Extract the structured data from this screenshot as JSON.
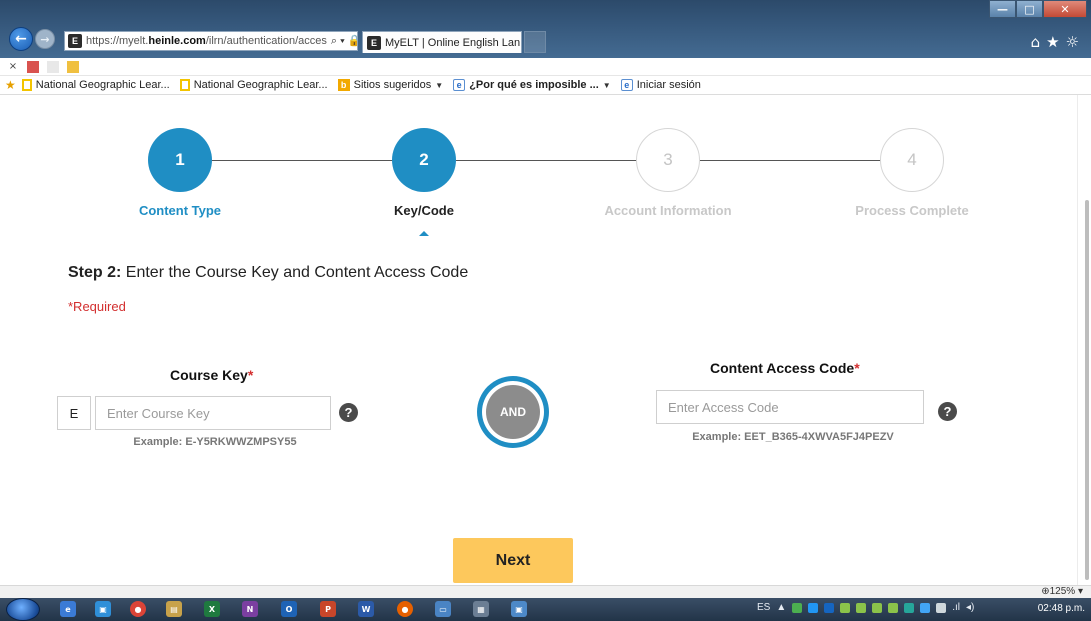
{
  "browser": {
    "url_prefix": "https://myelt.",
    "url_host": "heinle.com",
    "url_path": "/ilrn/authentication/acces",
    "tab_title": "MyELT | Online English Lan...",
    "tab_close": "×",
    "favicon_letter": "E",
    "addr_icons": "⌕ ▾ 🔒 ↻",
    "window_buttons": {
      "minimize": "—",
      "maximize": "□",
      "close": "✕"
    },
    "right_icons": "⌂★☼"
  },
  "cmdbar": {
    "close_glyph": "×"
  },
  "favorites": [
    {
      "label": "National Geographic Lear...",
      "icon": "ng-icon",
      "has_dropdown": false
    },
    {
      "label": "National Geographic Lear...",
      "icon": "ng-icon",
      "has_dropdown": false
    },
    {
      "label": "Sitios sugeridos",
      "icon": "bing-icon",
      "has_dropdown": true
    },
    {
      "label": "¿Por qué es imposible ...",
      "icon": "ie-icon",
      "has_dropdown": true
    },
    {
      "label": "Iniciar sesión",
      "icon": "ie-icon",
      "has_dropdown": false
    }
  ],
  "stepper": {
    "steps": [
      {
        "number": "1",
        "label": "Content Type",
        "state": "completed"
      },
      {
        "number": "2",
        "label": "Key/Code",
        "state": "current"
      },
      {
        "number": "3",
        "label": "Account Information",
        "state": "inactive"
      },
      {
        "number": "4",
        "label": "Process Complete",
        "state": "inactive"
      }
    ]
  },
  "heading": {
    "bold": "Step 2:",
    "text": " Enter the Course Key and Content Access Code"
  },
  "required_note": "*Required",
  "course_key": {
    "title": "Course Key",
    "required_marker": "*",
    "prefix": "E",
    "value": "",
    "placeholder": "Enter Course Key",
    "example": "Example: E-Y5RKWWZMPSY55",
    "help": "?"
  },
  "and_label": "AND",
  "access_code": {
    "title": "Content Access Code",
    "required_marker": "*",
    "value": "",
    "placeholder": "Enter Access Code",
    "example": "Example: EET_B365-4XWVA5FJ4PEZV",
    "help": "?"
  },
  "next_button": "Next",
  "statusbar": {
    "zoom": "125%"
  },
  "taskbar": {
    "language": "ES",
    "clock": "02:48 p.m.",
    "icon_labels": [
      "e",
      "▣",
      "●",
      "▤",
      "X",
      "N",
      "O",
      "P",
      "W",
      "●",
      "▭",
      "▦",
      "▣"
    ]
  },
  "colors": {
    "accent": "#1f8ec4",
    "next_button": "#fdc85c",
    "required": "#d32f2f"
  }
}
